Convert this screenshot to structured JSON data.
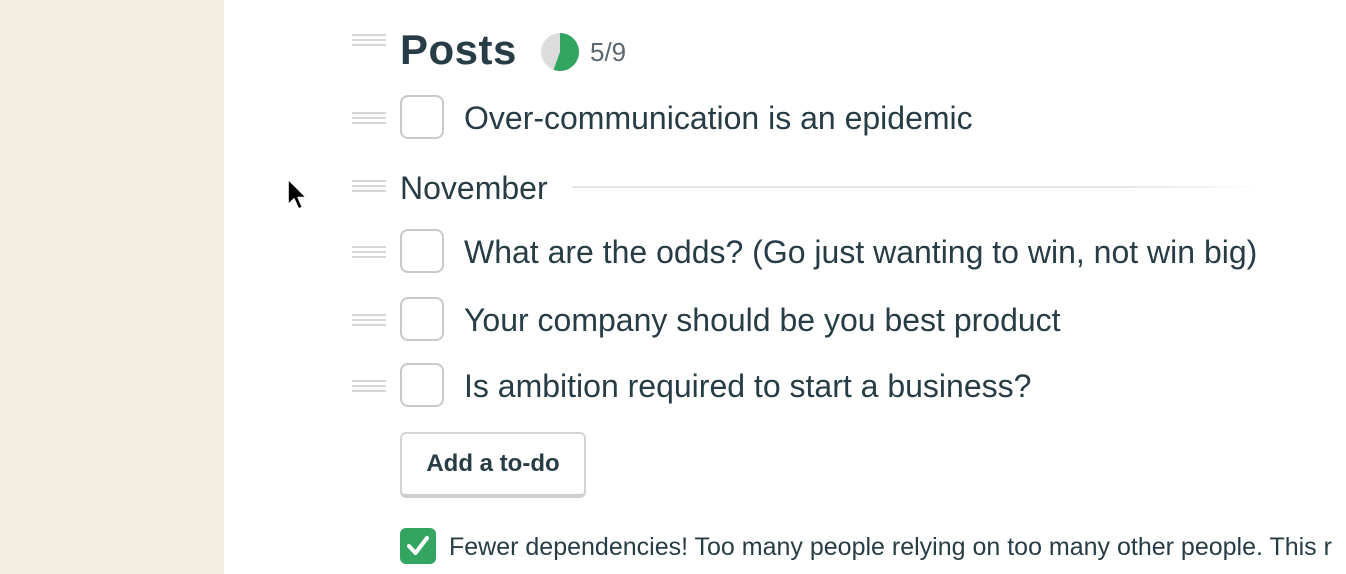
{
  "list": {
    "title": "Posts",
    "progress": {
      "completed": 5,
      "total": 9,
      "label": "5/9",
      "colors": {
        "done": "#33a560",
        "remaining": "#dcdcdc"
      }
    },
    "items_ungrouped": [
      {
        "text": "Over-communication is an epidemic",
        "checked": false
      }
    ],
    "group": {
      "label": "November",
      "items": [
        {
          "text": "What are the odds? (Go just wanting to win, not win big)",
          "checked": false
        },
        {
          "text": "Your company should be you best product",
          "checked": false
        },
        {
          "text": "Is ambition required to start a business?",
          "checked": false
        }
      ]
    },
    "add_button_label": "Add a to-do",
    "completed_items": [
      {
        "text": "Fewer dependencies! Too many people relying on too many other people. This r",
        "checked": true
      }
    ]
  },
  "theme": {
    "sidebar_bg": "#f4ede2",
    "text": "#283c46",
    "accent_green": "#33a560"
  },
  "icons": {
    "drag_handle": "drag-handle-icon",
    "checkmark": "checkmark-icon",
    "cursor": "mouse-pointer-icon"
  }
}
